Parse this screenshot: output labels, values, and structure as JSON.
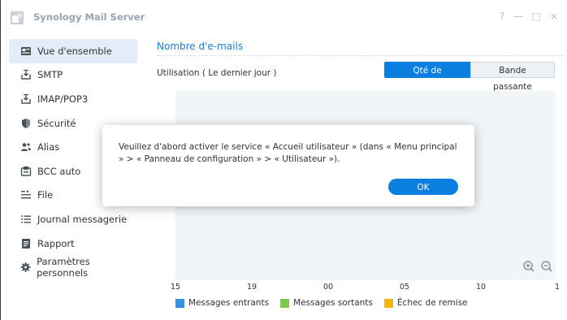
{
  "window": {
    "title": "Synology Mail Server",
    "controls": [
      "?",
      "—",
      "□",
      "×"
    ]
  },
  "sidebar": {
    "items": [
      {
        "label": "Vue d'ensemble",
        "icon": "overview-icon",
        "active": true
      },
      {
        "label": "SMTP",
        "icon": "inbox-tray-icon"
      },
      {
        "label": "IMAP/POP3",
        "icon": "inbox-tray-icon"
      },
      {
        "label": "Sécurité",
        "icon": "shield-icon"
      },
      {
        "label": "Alias",
        "icon": "users-icon"
      },
      {
        "label": "BCC auto",
        "icon": "bcc-icon"
      },
      {
        "label": "File",
        "icon": "queue-list-icon"
      },
      {
        "label": "Journal messagerie",
        "icon": "log-list-icon"
      },
      {
        "label": "Rapport",
        "icon": "report-icon"
      },
      {
        "label": "Paramètres personnels",
        "icon": "gear-icon"
      }
    ]
  },
  "main": {
    "section_title": "Nombre d'e-mails",
    "usage_label": "Utilisation ( Le dernier jour )",
    "toggle": {
      "messages": "Qté de messages",
      "bandwidth": "Bande passante",
      "selected": "messages"
    }
  },
  "chart_data": {
    "type": "line",
    "x_ticks": [
      "15",
      "19",
      "00",
      "05",
      "10",
      "1"
    ],
    "series": [
      {
        "name": "Messages entrants",
        "color": "#3a8fe0",
        "values": []
      },
      {
        "name": "Messages sortants",
        "color": "#7ac94a",
        "values": []
      },
      {
        "name": "Échec de remise",
        "color": "#f5b800",
        "values": []
      }
    ],
    "grid": false,
    "legend_position": "bottom-left"
  },
  "dialog": {
    "message": "Veuillez d'abord activer le service « Accueil utilisateur » (dans « Menu principal » > « Panneau de configuration » > « Utilisateur »).",
    "ok_label": "OK"
  },
  "colors": {
    "accent": "#0b7fe0",
    "title_blue": "#1d7bd3",
    "active_nav_bg": "#e2edf9"
  }
}
